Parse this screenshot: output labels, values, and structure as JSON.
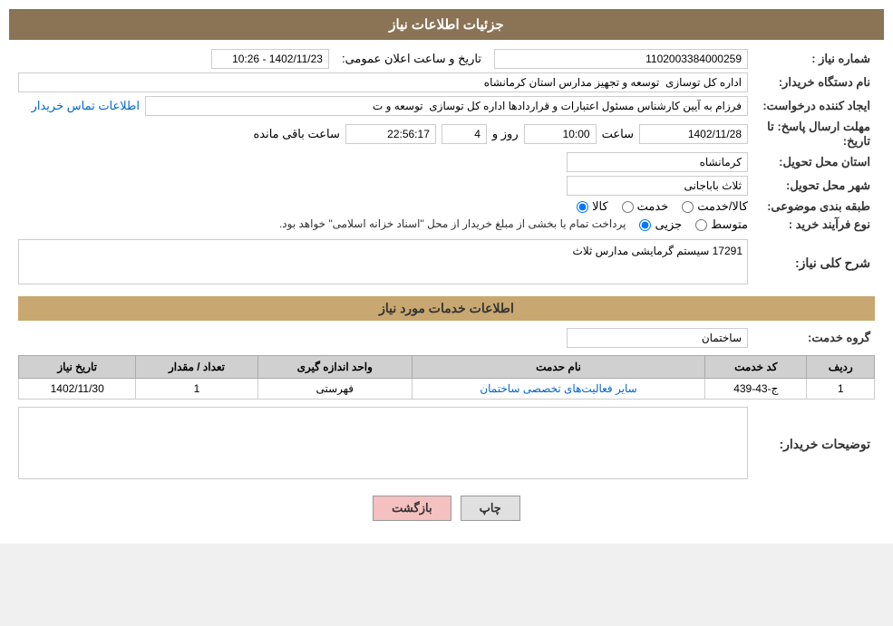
{
  "header": {
    "title": "جزئیات اطلاعات نیاز"
  },
  "fields": {
    "need_number_label": "شماره نیاز :",
    "need_number_value": "1102003384000259",
    "announcement_label": "تاریخ و ساعت اعلان عمومی:",
    "announcement_value": "1402/11/23 - 10:26",
    "buyer_name_label": "نام دستگاه خریدار:",
    "buyer_name_value": "اداره کل توسازی  توسعه و تجهیز مدارس استان کرمانشاه",
    "creator_label": "ایجاد کننده درخواست:",
    "creator_value": "فرزام به آیین کارشناس مسئول اعتبارات و قراردادها اداره کل توسازی  توسعه و ت",
    "creator_link": "اطلاعات تماس خریدار",
    "response_deadline_label": "مهلت ارسال پاسخ: تا تاریخ:",
    "deadline_date": "1402/11/28",
    "deadline_time": "10:00",
    "deadline_days": "4",
    "deadline_countdown": "22:56:17",
    "deadline_remaining": "ساعت باقی مانده",
    "province_label": "استان محل تحویل:",
    "province_value": "کرمانشاه",
    "city_label": "شهر محل تحویل:",
    "city_value": "ثلاث باباجانی",
    "category_label": "طبقه بندی موضوعی:",
    "category_option1": "کالا",
    "category_option2": "خدمت",
    "category_option3": "کالا/خدمت",
    "category_selected": "کالا",
    "process_label": "نوع فرآیند خرید :",
    "process_option1": "جزیی",
    "process_option2": "متوسط",
    "process_note": "پرداخت تمام یا بخشی از مبلغ خریدار از محل \"اسناد خزانه اسلامی\" خواهد بود.",
    "overall_desc_label": "شرح کلی نیاز:",
    "overall_desc_value": "17291 سیستم گرمایشی مدارس ثلاث",
    "services_info_title": "اطلاعات خدمات مورد نیاز",
    "service_group_label": "گروه خدمت:",
    "service_group_value": "ساختمان",
    "table": {
      "headers": [
        "ردیف",
        "کد خدمت",
        "نام حدمت",
        "واحد اندازه گیری",
        "تعداد / مقدار",
        "تاریخ نیاز"
      ],
      "rows": [
        {
          "row": "1",
          "code": "ج-43-439",
          "name": "سایر فعالیت‌های تخصصی ساختمان",
          "unit": "فهرستی",
          "quantity": "1",
          "date": "1402/11/30"
        }
      ]
    },
    "buyer_desc_label": "توضیحات خریدار:",
    "buyer_desc_value": "",
    "buttons": {
      "print": "چاپ",
      "back": "بازگشت"
    }
  }
}
